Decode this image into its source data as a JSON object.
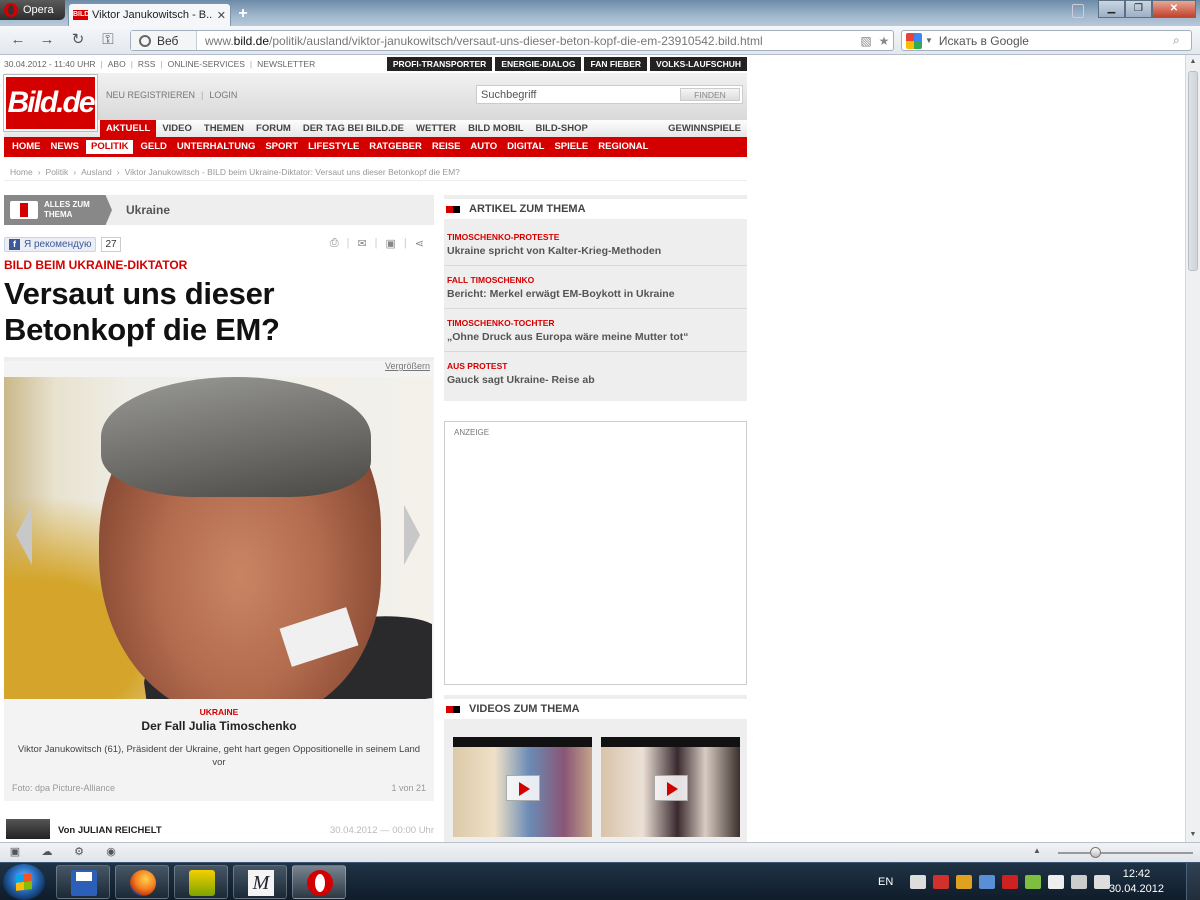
{
  "browser": {
    "menu_label": "Opera",
    "tab_title": "Viktor Janukowitsch - B...",
    "tab_favicon_text": "BILD",
    "url_prefix": "www.",
    "url_domain": "bild.de",
    "url_path": "/politik/ausland/viktor-janukowitsch/versaut-uns-dieser-beton-kopf-die-em-23910542.bild.html",
    "web_label": "Веб",
    "search_placeholder": "Искать в Google"
  },
  "bild": {
    "topstrip": {
      "date": "30.04.2012 - 11:40 UHR",
      "links": [
        "ABO",
        "RSS",
        "ONLINE-SERVICES",
        "NEWSLETTER"
      ],
      "pills": [
        "PROFI-TRANSPORTER",
        "ENERGIE-DIALOG",
        "FAN FIEBER",
        "VOLKS-LAUFSCHUH"
      ]
    },
    "logo": {
      "main": "Bild",
      "suffix": ".de"
    },
    "account": {
      "register": "NEU REGISTRIEREN",
      "login": "LOGIN"
    },
    "search": {
      "placeholder": "Suchbegriff",
      "button": "FINDEN"
    },
    "nav1": {
      "items": [
        "AKTUELL",
        "VIDEO",
        "THEMEN",
        "FORUM",
        "DER TAG BEI BILD.DE",
        "WETTER",
        "BILD MOBIL",
        "BILD-SHOP"
      ],
      "right": "GEWINNSPIELE"
    },
    "nav2": {
      "items": [
        "HOME",
        "NEWS",
        "POLITIK",
        "GELD",
        "UNTERHALTUNG",
        "SPORT",
        "LIFESTYLE",
        "RATGEBER",
        "REISE",
        "AUTO",
        "DIGITAL",
        "SPIELE",
        "REGIONAL"
      ]
    },
    "breadcrumb": [
      "Home",
      "Politik",
      "Ausland",
      "Viktor Janukowitsch - BILD beim Ukraine-Diktator: Versaut uns dieser Betonkopf die EM?"
    ],
    "thema": {
      "badge_line1": "ALLES ZUM",
      "badge_line2": "THEMA",
      "label": "Ukraine"
    },
    "social": {
      "like_label": "Я рекомендую",
      "like_count": "27"
    },
    "article": {
      "kicker": "BILD BEIM UKRAINE-DIKTATOR",
      "headline_line1": "Versaut uns dieser",
      "headline_line2": "Betonkopf die EM?"
    },
    "gallery": {
      "enlarge": "Vergrößern",
      "category": "UKRAINE",
      "title": "Der Fall Julia Timoschenko",
      "text": "Viktor Janukowitsch (61), Präsident der Ukraine, geht hart gegen Oppositionelle in seinem Land vor",
      "credit": "Foto: dpa Picture-Alliance",
      "counter": "1 von 21"
    },
    "author": {
      "name": "Von JULIAN REICHELT",
      "date": "30.04.2012 — 00:00 Uhr"
    },
    "articles_head": "ARTIKEL ZUM THEMA",
    "articles": [
      {
        "kicker": "TIMOSCHENKO-PROTESTE",
        "title": "Ukraine spricht von Kalter-Krieg-Methoden"
      },
      {
        "kicker": "FALL TIMOSCHENKO",
        "title": "Bericht: Merkel erwägt EM-Boykott in Ukraine"
      },
      {
        "kicker": "TIMOSCHENKO-TOCHTER",
        "title": "„Ohne Druck aus Europa wäre meine Mutter tot“"
      },
      {
        "kicker": "AUS PROTEST",
        "title": "Gauck sagt Ukraine- Reise ab"
      }
    ],
    "ad_label": "ANZEIGE",
    "videos_head": "VIDEOS ZUM THEMA"
  },
  "taskbar": {
    "language": "EN",
    "time": "12:42",
    "date": "30.04.2012",
    "math_icon_text": "M"
  },
  "colors": {
    "bild_red": "#d40000",
    "taskbar": "#1f3346"
  }
}
